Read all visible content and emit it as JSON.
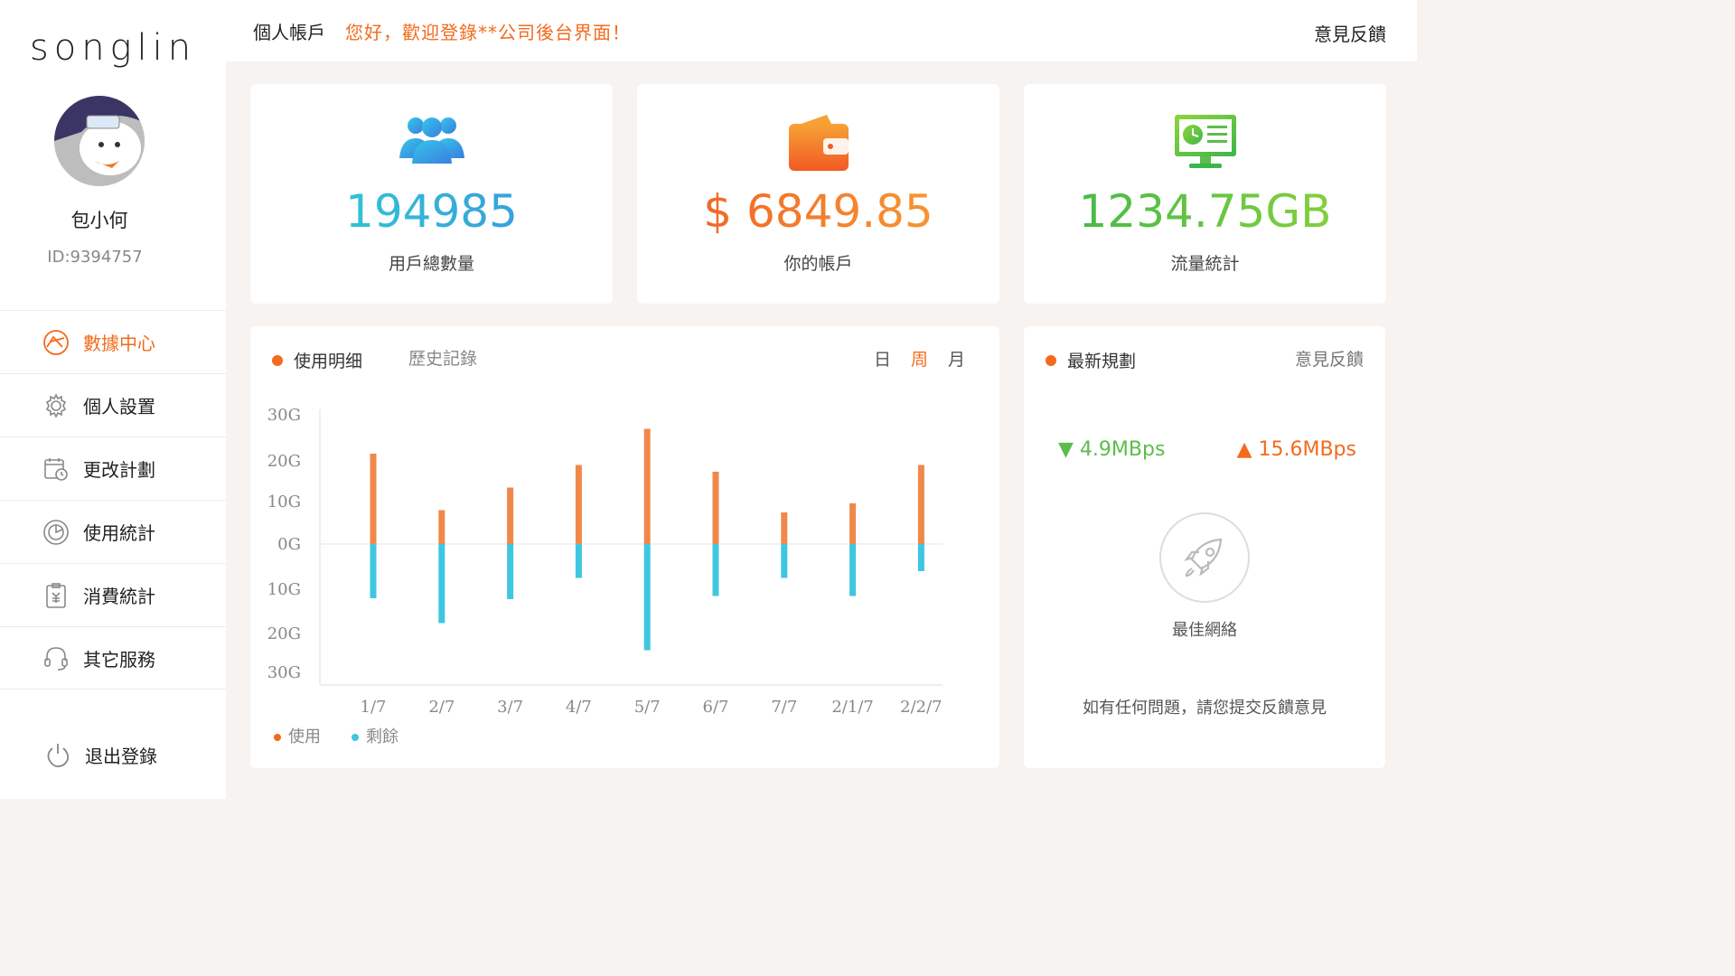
{
  "sidebar": {
    "logo": "songlin",
    "user": {
      "name": "包小何",
      "id": "ID:9394757"
    },
    "items": [
      {
        "label": "數據中心",
        "icon": "data-center-icon",
        "active": true
      },
      {
        "label": "個人設置",
        "icon": "gear-icon",
        "active": false
      },
      {
        "label": "更改計劃",
        "icon": "calendar-clock-icon",
        "active": false
      },
      {
        "label": "使用統計",
        "icon": "pie-chart-icon",
        "active": false
      },
      {
        "label": "消費統計",
        "icon": "yen-clipboard-icon",
        "active": false
      },
      {
        "label": "其它服務",
        "icon": "headset-icon",
        "active": false
      }
    ],
    "logout": "退出登錄"
  },
  "header": {
    "title": "個人帳戶",
    "welcome": "您好，歡迎登錄**公司後台界面！",
    "feedback": "意見反饋"
  },
  "stats": [
    {
      "value": "194985",
      "label": "用戶總數量",
      "icon": "users-icon"
    },
    {
      "value": "$ 6849.85",
      "label": "你的帳戶",
      "icon": "wallet-icon"
    },
    {
      "value": "1234.75GB",
      "label": "流量統計",
      "icon": "monitor-icon"
    }
  ],
  "usage": {
    "title": "使用明细",
    "history": "歷史記錄",
    "ranges": [
      "日",
      "周",
      "月"
    ],
    "selected_range": "周",
    "legend": [
      "使用",
      "剩餘"
    ],
    "accent": "#f26b1d"
  },
  "chart_data": {
    "type": "bar",
    "categories": [
      "1/7",
      "2/7",
      "3/7",
      "4/7",
      "5/7",
      "6/7",
      "7/7",
      "2/1/7",
      "2/2/7"
    ],
    "y_tick_labels": [
      "30G",
      "20G",
      "10G",
      "0G",
      "10G",
      "20G",
      "30G"
    ],
    "ylim": [
      -30,
      30
    ],
    "series": [
      {
        "name": "使用",
        "color": "#f0884a",
        "values": [
          20,
          7.5,
          12.5,
          17.5,
          25.5,
          16,
          7,
          9,
          17.5
        ]
      },
      {
        "name": "剩餘",
        "color": "#3fc6e1",
        "values": [
          -12,
          -17.5,
          -12.2,
          -7.5,
          -23.5,
          -11.5,
          -7.5,
          -11.5,
          -6
        ]
      }
    ]
  },
  "plan": {
    "title": "最新規劃",
    "feedback": "意見反饋",
    "down": "4.9MBps",
    "up": "15.6MBps",
    "best": "最佳網絡",
    "note": "如有任何問題，請您提交反饋意見"
  }
}
